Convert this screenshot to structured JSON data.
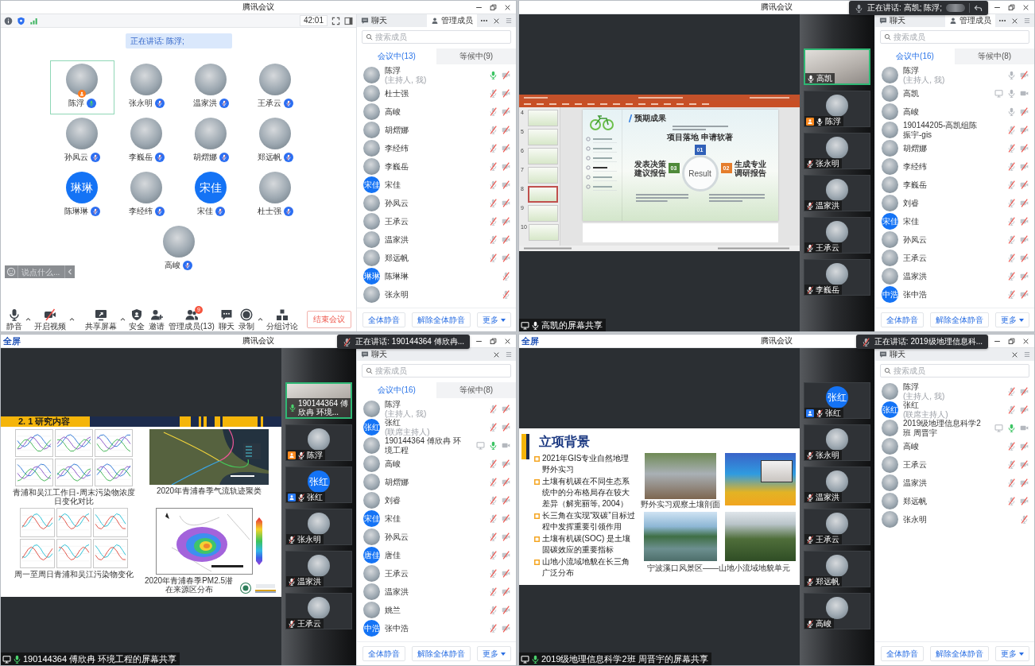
{
  "windows": [
    {
      "kind": "gallery",
      "title_bar": {
        "title": "腾讯会议"
      },
      "top_bar": {
        "timer": "42:01"
      },
      "speaking": "正在讲话: 陈浮;",
      "participants": [
        {
          "name": "陈浮",
          "avatar": {
            "kind": "photo"
          },
          "muted": false,
          "speaking": true,
          "host": true,
          "selected": true
        },
        {
          "name": "张永明",
          "avatar": {
            "kind": "photo"
          },
          "muted": true,
          "host": false,
          "selected": false
        },
        {
          "name": "温家洪",
          "avatar": {
            "kind": "photo"
          },
          "muted": true,
          "host": false,
          "selected": false
        },
        {
          "name": "王承云",
          "avatar": {
            "kind": "photo"
          },
          "muted": true,
          "host": false,
          "selected": false
        },
        {
          "name": "孙凤云",
          "avatar": {
            "kind": "photo"
          },
          "muted": true,
          "host": false,
          "selected": false
        },
        {
          "name": "李巍岳",
          "avatar": {
            "kind": "photo"
          },
          "muted": true,
          "host": false,
          "selected": false
        },
        {
          "name": "胡熠娜",
          "avatar": {
            "kind": "photo"
          },
          "muted": true,
          "host": false,
          "selected": false
        },
        {
          "name": "郑远帆",
          "avatar": {
            "kind": "photo"
          },
          "muted": true,
          "host": false,
          "selected": false
        },
        {
          "name": "陈琳琳",
          "avatar": {
            "kind": "text",
            "text": "琳琳"
          },
          "muted": true,
          "host": false,
          "selected": false
        },
        {
          "name": "李经纬",
          "avatar": {
            "kind": "photo"
          },
          "muted": true,
          "host": false,
          "selected": false
        },
        {
          "name": "宋佳",
          "avatar": {
            "kind": "text",
            "text": "宋佳"
          },
          "muted": true,
          "host": false,
          "selected": false
        },
        {
          "name": "杜士强",
          "avatar": {
            "kind": "photo"
          },
          "muted": true,
          "host": false,
          "selected": false
        },
        {
          "name": "高峻",
          "avatar": {
            "kind": "photo"
          },
          "muted": true,
          "host": false,
          "selected": false
        }
      ],
      "chat_input": {
        "placeholder": "说点什么..."
      },
      "toolbar": [
        {
          "kind": "mic",
          "label": "静音",
          "caret": true
        },
        {
          "kind": "video_off",
          "label": "开启视频",
          "caret": true
        },
        {
          "kind": "share",
          "label": "共享屏幕",
          "caret": true
        },
        {
          "kind": "security",
          "label": "安全",
          "caret": false
        },
        {
          "kind": "invite",
          "label": "邀请",
          "caret": false
        },
        {
          "kind": "members",
          "label": "管理成员(13)",
          "caret": false,
          "badge": "9"
        },
        {
          "kind": "chat",
          "label": "聊天",
          "caret": false
        },
        {
          "kind": "record",
          "label": "录制",
          "caret": true
        },
        {
          "kind": "breakout",
          "label": "分组讨论",
          "caret": false
        }
      ],
      "end_button": "结束会议",
      "panel": {
        "tabs": [
          {
            "kind": "chat",
            "label": "聊天",
            "selected": false
          },
          {
            "kind": "members",
            "label": "管理成员",
            "selected": true
          }
        ],
        "search": {
          "placeholder": "搜索成员"
        },
        "subtabs": [
          {
            "label": "会议中(13)",
            "selected": true
          },
          {
            "label": "等候中(9)",
            "selected": false
          }
        ],
        "members": [
          {
            "name": "陈浮",
            "role": "(主持人, 我)",
            "avatar": {
              "kind": "photo"
            },
            "sharing": false,
            "muted": false,
            "speaking": true,
            "video_off": true
          },
          {
            "name": "杜士强",
            "avatar": {
              "kind": "photo"
            },
            "sharing": false,
            "muted": true,
            "video_off": true
          },
          {
            "name": "高峻",
            "avatar": {
              "kind": "photo"
            },
            "sharing": false,
            "muted": true,
            "video_off": true
          },
          {
            "name": "胡熠娜",
            "avatar": {
              "kind": "photo"
            },
            "sharing": false,
            "muted": true,
            "video_off": true
          },
          {
            "name": "李经纬",
            "avatar": {
              "kind": "photo"
            },
            "sharing": false,
            "muted": true,
            "video_off": true
          },
          {
            "name": "李巍岳",
            "avatar": {
              "kind": "photo"
            },
            "sharing": false,
            "muted": true,
            "video_off": true
          },
          {
            "name": "宋佳",
            "avatar": {
              "kind": "text",
              "text": "宋佳"
            },
            "sharing": false,
            "muted": true,
            "video_off": true
          },
          {
            "name": "孙凤云",
            "avatar": {
              "kind": "photo"
            },
            "sharing": false,
            "muted": true,
            "video_off": true
          },
          {
            "name": "王承云",
            "avatar": {
              "kind": "photo"
            },
            "sharing": false,
            "muted": true,
            "video_off": true
          },
          {
            "name": "温家洪",
            "avatar": {
              "kind": "photo"
            },
            "sharing": false,
            "muted": true,
            "video_off": true
          },
          {
            "name": "郑远帆",
            "avatar": {
              "kind": "photo"
            },
            "sharing": false,
            "muted": true,
            "video_off": true
          },
          {
            "name": "陈琳琳",
            "avatar": {
              "kind": "text",
              "text": "琳琳"
            },
            "sharing": false,
            "muted": true
          },
          {
            "name": "张永明",
            "avatar": {
              "kind": "photo"
            },
            "sharing": false,
            "muted": true
          }
        ],
        "footer": [
          {
            "label": "全体静音",
            "menu": false
          },
          {
            "label": "解除全体静音",
            "menu": false
          },
          {
            "label": "更多",
            "menu": true
          }
        ]
      }
    },
    {
      "kind": "screen_share",
      "title_bar": {
        "title": "腾讯会议"
      },
      "share": {
        "label": "高凯的屏幕共享",
        "speaking": false,
        "slide": {
          "kind": "powerpoint",
          "thumbnails": [
            {
              "number": "4",
              "selected": false
            },
            {
              "number": "5",
              "selected": false
            },
            {
              "number": "6",
              "selected": false
            },
            {
              "number": "7",
              "selected": false
            },
            {
              "number": "8",
              "selected": true
            },
            {
              "number": "9",
              "selected": false
            },
            {
              "number": "10",
              "selected": false
            }
          ],
          "heading": "预期成果",
          "top_label": "项目落地 申请软著",
          "center": "Result",
          "steps": [
            "01",
            "02",
            "03"
          ],
          "left_label": "发表决策建议报告",
          "right_label": "生成专业调研报告"
        }
      },
      "videos": [
        {
          "name": "高凯",
          "avatar": {
            "kind": "camera"
          },
          "muted": false,
          "speaking": false,
          "host": false,
          "cohost": false,
          "selected": true
        },
        {
          "name": "陈浮",
          "avatar": {
            "kind": "photo"
          },
          "muted": false,
          "speaking": false,
          "host": true,
          "cohost": false,
          "selected": false
        },
        {
          "name": "张永明",
          "avatar": {
            "kind": "photo"
          },
          "muted": true,
          "host": false,
          "cohost": false,
          "selected": false
        },
        {
          "name": "温家洪",
          "avatar": {
            "kind": "photo"
          },
          "muted": true,
          "host": false,
          "cohost": false,
          "selected": false
        },
        {
          "name": "王承云",
          "avatar": {
            "kind": "photo"
          },
          "muted": true,
          "host": false,
          "cohost": false,
          "selected": false
        },
        {
          "name": "李巍岳",
          "avatar": {
            "kind": "photo"
          },
          "muted": true,
          "host": false,
          "cohost": false,
          "selected": false
        }
      ],
      "toast": {
        "text": "正在讲话: 高凯; 陈浮;",
        "muted": false,
        "blurred": true,
        "return_button": true
      },
      "panel": {
        "tabs": [
          {
            "kind": "chat",
            "label": "聊天",
            "selected": false
          },
          {
            "kind": "members",
            "label": "管理成员",
            "selected": true
          }
        ],
        "search": {
          "placeholder": "搜索成员"
        },
        "subtabs": [
          {
            "label": "会议中(16)",
            "selected": true
          },
          {
            "label": "等候中(8)",
            "selected": false
          }
        ],
        "members": [
          {
            "name": "陈浮",
            "role": "(主持人, 我)",
            "avatar": {
              "kind": "photo"
            },
            "sharing": false,
            "muted": false,
            "speaking": false,
            "video_off": true
          },
          {
            "name": "高凯",
            "avatar": {
              "kind": "photo"
            },
            "sharing": true,
            "muted": false,
            "speaking": false,
            "video_off": false
          },
          {
            "name": "高峻",
            "avatar": {
              "kind": "photo"
            },
            "sharing": false,
            "muted": false,
            "speaking": false,
            "video_off": true
          },
          {
            "name": "190144205-高凯组陈振宇-gis",
            "avatar": {
              "kind": "photo"
            },
            "sharing": false,
            "muted": true,
            "video_off": true
          },
          {
            "name": "胡熠娜",
            "avatar": {
              "kind": "photo"
            },
            "sharing": false,
            "muted": true,
            "video_off": true
          },
          {
            "name": "李经纬",
            "avatar": {
              "kind": "photo"
            },
            "sharing": false,
            "muted": true,
            "video_off": true
          },
          {
            "name": "李巍岳",
            "avatar": {
              "kind": "photo"
            },
            "sharing": false,
            "muted": true,
            "video_off": true
          },
          {
            "name": "刘睿",
            "avatar": {
              "kind": "photo"
            },
            "sharing": false,
            "muted": true,
            "video_off": true
          },
          {
            "name": "宋佳",
            "avatar": {
              "kind": "text",
              "text": "宋佳"
            },
            "sharing": false,
            "muted": true,
            "video_off": true
          },
          {
            "name": "孙凤云",
            "avatar": {
              "kind": "photo"
            },
            "sharing": false,
            "muted": true,
            "video_off": true
          },
          {
            "name": "王承云",
            "avatar": {
              "kind": "photo"
            },
            "sharing": false,
            "muted": true,
            "video_off": true
          },
          {
            "name": "温家洪",
            "avatar": {
              "kind": "photo"
            },
            "sharing": false,
            "muted": true,
            "video_off": true
          },
          {
            "name": "张中浩",
            "avatar": {
              "kind": "text",
              "text": "中浩"
            },
            "sharing": false,
            "muted": true,
            "video_off": true
          }
        ],
        "footer": [
          {
            "label": "全体静音",
            "menu": false
          },
          {
            "label": "解除全体静音",
            "menu": false
          },
          {
            "label": "更多",
            "menu": true
          }
        ]
      }
    },
    {
      "kind": "screen_share",
      "title_bar": {
        "logo": "全屏",
        "title": "腾讯会议"
      },
      "share": {
        "label": "190144364 傅欣冉 环境工程的屏幕共享",
        "speaking": true,
        "slide": {
          "kind": "research",
          "heading": "2. 1 研究内容",
          "figures": [
            {
              "kind": "line_grid",
              "caption": "青浦和吴江工作日-周末污染物浓度日变化对比"
            },
            {
              "kind": "trajectory_map",
              "caption": "2020年青浦春季气流轨迹聚类"
            },
            {
              "kind": "comparison_grid",
              "caption": "周一至周日青浦和吴江污染物变化"
            },
            {
              "kind": "source_map",
              "caption": "2020年青浦春季PM2.5潜在来源区分布"
            }
          ]
        }
      },
      "videos": [
        {
          "name": "190144364 傅欣冉 环境...",
          "avatar": {
            "kind": "camera"
          },
          "muted": false,
          "speaking": true,
          "host": false,
          "cohost": false,
          "selected": true
        },
        {
          "name": "陈浮",
          "avatar": {
            "kind": "photo"
          },
          "muted": true,
          "host": true,
          "cohost": false,
          "selected": false
        },
        {
          "name": "张红",
          "avatar": {
            "kind": "text",
            "text": "张红"
          },
          "muted": true,
          "host": false,
          "cohost": true,
          "selected": false
        },
        {
          "name": "张永明",
          "avatar": {
            "kind": "photo"
          },
          "muted": true,
          "host": false,
          "cohost": false,
          "selected": false
        },
        {
          "name": "温家洪",
          "avatar": {
            "kind": "photo"
          },
          "muted": true,
          "host": false,
          "cohost": false,
          "selected": false
        },
        {
          "name": "王承云",
          "avatar": {
            "kind": "photo"
          },
          "muted": true,
          "host": false,
          "cohost": false,
          "selected": false
        }
      ],
      "toast": {
        "text": "正在讲话: 190144364 傅欣冉...",
        "muted": true,
        "blurred": false,
        "return_button": false
      },
      "panel": {
        "tabs": [
          {
            "kind": "chat",
            "label": "聊天",
            "selected": false
          }
        ],
        "search": {
          "placeholder": "搜索成员"
        },
        "subtabs": [
          {
            "label": "会议中(16)",
            "selected": true
          },
          {
            "label": "等候中(8)",
            "selected": false
          }
        ],
        "members": [
          {
            "name": "陈浮",
            "role": "(主持人, 我)",
            "avatar": {
              "kind": "photo"
            },
            "sharing": false,
            "muted": true,
            "video_off": true
          },
          {
            "name": "张红",
            "role": "(联席主持人)",
            "avatar": {
              "kind": "text",
              "text": "张红"
            },
            "sharing": false,
            "muted": true,
            "video_off": true
          },
          {
            "name": "190144364 傅欣冉 环境工程",
            "avatar": {
              "kind": "photo"
            },
            "sharing": true,
            "muted": false,
            "speaking": true,
            "video_off": false
          },
          {
            "name": "高峻",
            "avatar": {
              "kind": "photo"
            },
            "sharing": false,
            "muted": true,
            "video_off": true
          },
          {
            "name": "胡熠娜",
            "avatar": {
              "kind": "photo"
            },
            "sharing": false,
            "muted": true,
            "video_off": true
          },
          {
            "name": "刘睿",
            "avatar": {
              "kind": "photo"
            },
            "sharing": false,
            "muted": true,
            "video_off": true
          },
          {
            "name": "宋佳",
            "avatar": {
              "kind": "text",
              "text": "宋佳"
            },
            "sharing": false,
            "muted": true,
            "video_off": true
          },
          {
            "name": "孙凤云",
            "avatar": {
              "kind": "photo"
            },
            "sharing": false,
            "muted": true,
            "video_off": true
          },
          {
            "name": "唐佳",
            "avatar": {
              "kind": "text",
              "text": "唐佳"
            },
            "sharing": false,
            "muted": true,
            "video_off": true
          },
          {
            "name": "王承云",
            "avatar": {
              "kind": "photo"
            },
            "sharing": false,
            "muted": true,
            "video_off": true
          },
          {
            "name": "温家洪",
            "avatar": {
              "kind": "photo"
            },
            "sharing": false,
            "muted": true,
            "video_off": true
          },
          {
            "name": "姚兰",
            "avatar": {
              "kind": "photo"
            },
            "sharing": false,
            "muted": true,
            "video_off": true
          },
          {
            "name": "张中浩",
            "avatar": {
              "kind": "text",
              "text": "中浩"
            },
            "sharing": false,
            "muted": true,
            "video_off": true
          }
        ],
        "footer": [
          {
            "label": "全体静音",
            "menu": false
          },
          {
            "label": "解除全体静音",
            "menu": false
          },
          {
            "label": "更多",
            "menu": true
          }
        ]
      }
    },
    {
      "kind": "screen_share",
      "title_bar": {
        "logo": "全屏",
        "title": "腾讯会议"
      },
      "share": {
        "label": "2019级地理信息科学2班 周晋宇的屏幕共享",
        "speaking": true,
        "slide": {
          "kind": "background",
          "heading": "立项背景",
          "bullets": [
            "2021年GIS专业自然地理野外实习",
            "土壤有机碳在不同生态系统中的分布格局存在较大差异（解宪丽等, 2004）",
            "长三角在实现“双碳”目标过程中发挥重要引领作用",
            "土壤有机碳(SOC) 是土壤固碳效应的重要指标",
            "山地小流域地貌在长三角广泛分布"
          ],
          "photos": [
            {
              "kind": "field",
              "caption": "野外实习观察土壤剖面"
            },
            {
              "kind": "map"
            },
            {
              "kind": "lake"
            },
            {
              "kind": "mountain"
            }
          ],
          "photos_caption": "宁波溪口风景区——山地小流域地貌单元"
        }
      },
      "videos": [
        {
          "name": "张红",
          "avatar": {
            "kind": "text",
            "text": "张红"
          },
          "muted": true,
          "host": false,
          "cohost": true,
          "selected": false
        },
        {
          "name": "张永明",
          "avatar": {
            "kind": "photo"
          },
          "muted": true,
          "host": false,
          "cohost": false,
          "selected": false
        },
        {
          "name": "温家洪",
          "avatar": {
            "kind": "photo"
          },
          "muted": true,
          "host": false,
          "cohost": false,
          "selected": false
        },
        {
          "name": "王承云",
          "avatar": {
            "kind": "photo"
          },
          "muted": true,
          "host": false,
          "cohost": false,
          "selected": false
        },
        {
          "name": "郑远帆",
          "avatar": {
            "kind": "photo"
          },
          "muted": true,
          "host": false,
          "cohost": false,
          "selected": false
        },
        {
          "name": "高峻",
          "avatar": {
            "kind": "photo"
          },
          "muted": true,
          "host": false,
          "cohost": false,
          "selected": false
        }
      ],
      "toast": {
        "text": "正在讲话: 2019级地理信息科...",
        "muted": true,
        "blurred": false,
        "return_button": false
      },
      "panel": {
        "tabs": [
          {
            "kind": "chat",
            "label": "聊天",
            "selected": false
          }
        ],
        "search": {
          "placeholder": "搜索成员"
        },
        "members": [
          {
            "name": "陈浮",
            "role": "(主持人, 我)",
            "avatar": {
              "kind": "photo"
            },
            "sharing": false,
            "muted": true,
            "video_off": true
          },
          {
            "name": "张红",
            "role": "(联席主持人)",
            "avatar": {
              "kind": "text",
              "text": "张红"
            },
            "sharing": false,
            "muted": true,
            "video_off": true
          },
          {
            "name": "2019级地理信息科学2班 周晋宇",
            "avatar": {
              "kind": "photo"
            },
            "sharing": true,
            "muted": false,
            "speaking": true,
            "video_off": false
          },
          {
            "name": "高峻",
            "avatar": {
              "kind": "photo"
            },
            "sharing": false,
            "muted": true,
            "video_off": true
          },
          {
            "name": "王承云",
            "avatar": {
              "kind": "photo"
            },
            "sharing": false,
            "muted": true,
            "video_off": true
          },
          {
            "name": "温家洪",
            "avatar": {
              "kind": "photo"
            },
            "sharing": false,
            "muted": true,
            "video_off": true
          },
          {
            "name": "郑远帆",
            "avatar": {
              "kind": "photo"
            },
            "sharing": false,
            "muted": true,
            "video_off": true
          },
          {
            "name": "张永明",
            "avatar": {
              "kind": "photo"
            },
            "sharing": false,
            "muted": true
          }
        ],
        "footer": [
          {
            "label": "全体静音",
            "menu": false
          },
          {
            "label": "解除全体静音",
            "menu": false
          },
          {
            "label": "更多",
            "menu": true
          }
        ]
      }
    }
  ]
}
